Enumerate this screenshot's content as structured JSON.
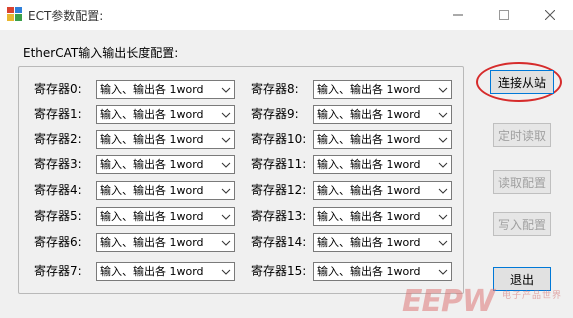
{
  "window": {
    "title": "ECT参数配置:",
    "controls": [
      "minimize",
      "maximize",
      "close"
    ]
  },
  "group": {
    "title": "EtherCAT输入输出长度配置:"
  },
  "registers_left": [
    {
      "label": "寄存器0:",
      "value": "输入、输出各 1word"
    },
    {
      "label": "寄存器1:",
      "value": "输入、输出各 1word"
    },
    {
      "label": "寄存器2:",
      "value": "输入、输出各 1word"
    },
    {
      "label": "寄存器3:",
      "value": "输入、输出各 1word"
    },
    {
      "label": "寄存器4:",
      "value": "输入、输出各 1word"
    },
    {
      "label": "寄存器5:",
      "value": "输入、输出各 1word"
    },
    {
      "label": "寄存器6:",
      "value": "输入、输出各 1word"
    },
    {
      "label": "寄存器7:",
      "value": "输入、输出各 1word"
    }
  ],
  "registers_right": [
    {
      "label": "寄存器8:",
      "value": "输入、输出各 1word"
    },
    {
      "label": "寄存器9:",
      "value": "输入、输出各 1word"
    },
    {
      "label": "寄存器10:",
      "value": "输入、输出各 1word"
    },
    {
      "label": "寄存器11:",
      "value": "输入、输出各 1word"
    },
    {
      "label": "寄存器12:",
      "value": "输入、输出各 1word"
    },
    {
      "label": "寄存器13:",
      "value": "输入、输出各 1word"
    },
    {
      "label": "寄存器14:",
      "value": "输入、输出各 1word"
    },
    {
      "label": "寄存器15:",
      "value": "输入、输出各 1word"
    }
  ],
  "buttons": {
    "connect": "连接从站",
    "timed_read": "定时读取",
    "read_config": "读取配置",
    "write_config": "写入配置",
    "exit": "退出"
  },
  "watermark": {
    "logo": "EEPW",
    "subtitle": "电子产品世界"
  },
  "colors": {
    "annotation_ellipse": "#d62b2b",
    "focus_border": "#0078d7",
    "disabled_text": "#a0a0a0"
  }
}
